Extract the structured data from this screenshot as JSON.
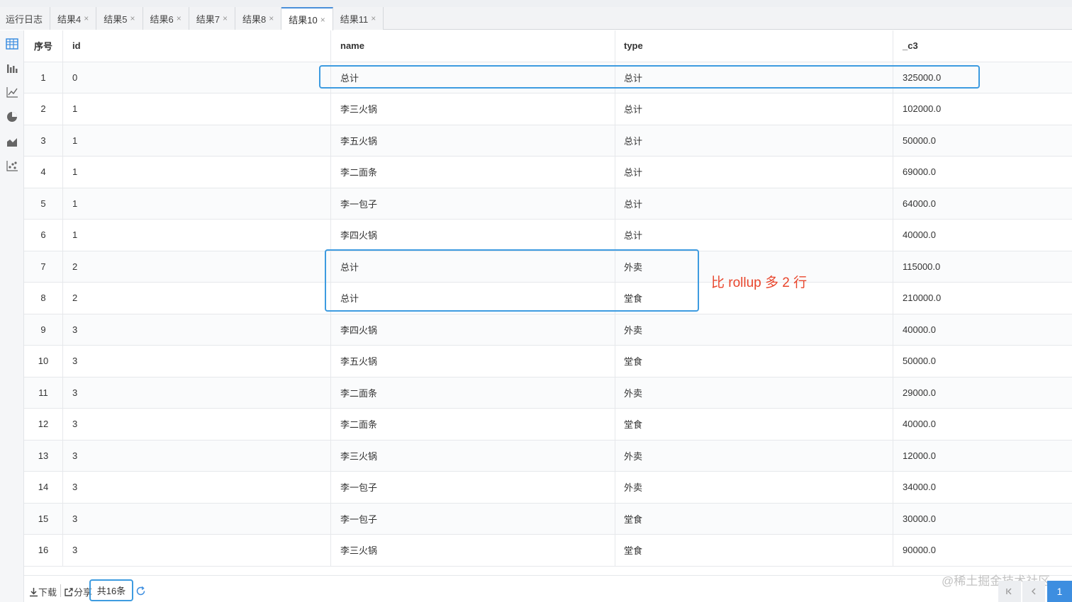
{
  "tabs": [
    {
      "label": "运行日志",
      "closable": false,
      "active": false
    },
    {
      "label": "结果4",
      "closable": true,
      "active": false
    },
    {
      "label": "结果5",
      "closable": true,
      "active": false
    },
    {
      "label": "结果6",
      "closable": true,
      "active": false
    },
    {
      "label": "结果7",
      "closable": true,
      "active": false
    },
    {
      "label": "结果8",
      "closable": true,
      "active": false
    },
    {
      "label": "结果10",
      "closable": true,
      "active": true
    },
    {
      "label": "结果11",
      "closable": true,
      "active": false
    }
  ],
  "tab_close_glyph": "×",
  "left_icons": [
    "table-icon",
    "bar-chart-icon",
    "line-chart-icon",
    "pie-chart-icon",
    "area-chart-icon",
    "scatter-chart-icon"
  ],
  "table": {
    "columns": [
      "序号",
      "id",
      "name",
      "type",
      "_c3"
    ],
    "rows": [
      [
        "1",
        "0",
        "总计",
        "总计",
        "325000.0"
      ],
      [
        "2",
        "1",
        "李三火锅",
        "总计",
        "102000.0"
      ],
      [
        "3",
        "1",
        "李五火锅",
        "总计",
        "50000.0"
      ],
      [
        "4",
        "1",
        "李二面条",
        "总计",
        "69000.0"
      ],
      [
        "5",
        "1",
        "李一包子",
        "总计",
        "64000.0"
      ],
      [
        "6",
        "1",
        "李四火锅",
        "总计",
        "40000.0"
      ],
      [
        "7",
        "2",
        "总计",
        "外卖",
        "115000.0"
      ],
      [
        "8",
        "2",
        "总计",
        "堂食",
        "210000.0"
      ],
      [
        "9",
        "3",
        "李四火锅",
        "外卖",
        "40000.0"
      ],
      [
        "10",
        "3",
        "李五火锅",
        "堂食",
        "50000.0"
      ],
      [
        "11",
        "3",
        "李二面条",
        "外卖",
        "29000.0"
      ],
      [
        "12",
        "3",
        "李二面条",
        "堂食",
        "40000.0"
      ],
      [
        "13",
        "3",
        "李三火锅",
        "外卖",
        "12000.0"
      ],
      [
        "14",
        "3",
        "李一包子",
        "外卖",
        "34000.0"
      ],
      [
        "15",
        "3",
        "李一包子",
        "堂食",
        "30000.0"
      ],
      [
        "16",
        "3",
        "李三火锅",
        "堂食",
        "90000.0"
      ]
    ]
  },
  "annotation": "比 rollup 多 2 行",
  "footer": {
    "download": "下载",
    "share": "分享",
    "count": "共16条",
    "watermark": "@稀土掘金技术社区",
    "pager_current": "1"
  },
  "colors": {
    "highlight": "#3d9be0",
    "annotation": "#e8452c",
    "active_tab": "#4a90d9"
  }
}
